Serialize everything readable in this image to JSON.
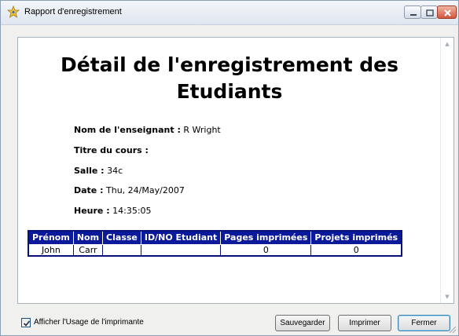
{
  "window": {
    "title": "Rapport d'enregistrement",
    "icon": "star-icon"
  },
  "report": {
    "title": "Détail de l'enregistrement des Etudiants",
    "teacher_label": "Nom de l'enseignant :",
    "teacher_value": "R Wright",
    "course_label": "Titre du cours :",
    "course_value": "",
    "room_label": "Salle :",
    "room_value": "34c",
    "date_label": "Date :",
    "date_value": "Thu, 24/May/2007",
    "time_label": "Heure :",
    "time_value": "14:35:05"
  },
  "table": {
    "headers": [
      "Prénom",
      "Nom",
      "Classe",
      "ID/NO Etudiant",
      "Pages imprimées",
      "Projets imprimés"
    ],
    "rows": [
      [
        "John",
        "Carr",
        "",
        "",
        "0",
        "0"
      ]
    ]
  },
  "footer": {
    "checkbox_label": "Afficher l'Usage de l'imprimante",
    "checkbox_checked": true,
    "save_label": "Sauvegarder",
    "print_label": "Imprimer",
    "close_label": "Fermer"
  },
  "colors": {
    "header_bg": "#0b1a9a",
    "header_text": "#ffffff",
    "table_border": "#06127a"
  }
}
